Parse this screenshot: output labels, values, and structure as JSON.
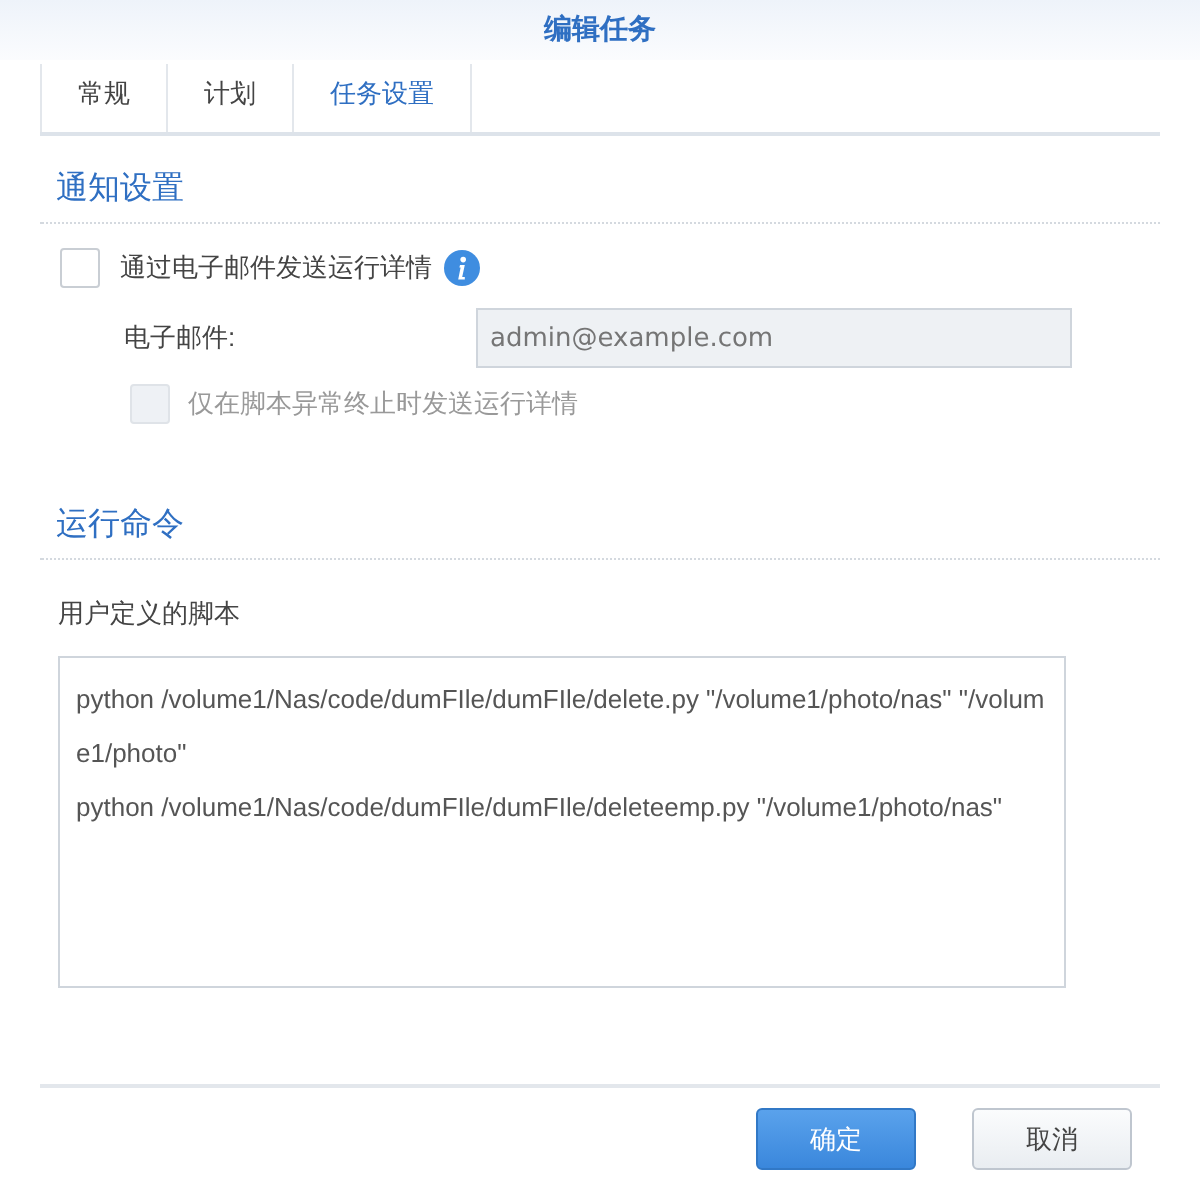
{
  "window": {
    "title": "编辑任务"
  },
  "tabs": [
    {
      "label": "常规",
      "selected": false
    },
    {
      "label": "计划",
      "selected": false
    },
    {
      "label": "任务设置",
      "selected": true
    }
  ],
  "notification": {
    "heading": "通知设置",
    "send_details": {
      "label": "通过电子邮件发送运行详情",
      "checked": false
    },
    "email": {
      "label": "电子邮件:",
      "placeholder": "admin@example.com",
      "disabled": true
    },
    "only_on_error": {
      "label": "仅在脚本异常终止时发送运行详情",
      "checked": false,
      "disabled": true
    }
  },
  "run_command": {
    "heading": "运行命令",
    "script_label": "用户定义的脚本",
    "script": "python /volume1/Nas/code/dumFIle/dumFIle/delete.py \"/volume1/photo/nas\" \"/volume1/photo\"\npython /volume1/Nas/code/dumFIle/dumFIle/deleteemp.py \"/volume1/photo/nas\""
  },
  "buttons": [
    {
      "label": "确定",
      "kind": "primary"
    },
    {
      "label": "取消",
      "kind": "secondary"
    }
  ]
}
